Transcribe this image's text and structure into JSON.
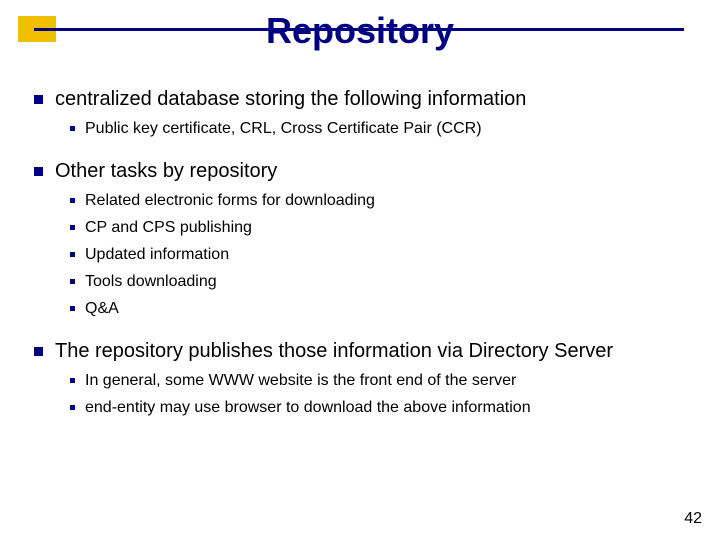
{
  "title": "Repository",
  "bullets": {
    "b1": "centralized database storing the following information",
    "b1_1": "Public key certificate, CRL, Cross Certificate Pair (CCR)",
    "b2": "Other tasks by repository",
    "b2_1": "Related electronic forms for downloading",
    "b2_2": "CP and CPS publishing",
    "b2_3": "Updated information",
    "b2_4": "Tools downloading",
    "b2_5": "Q&A",
    "b3": "The repository publishes those information via Directory Server",
    "b3_1": "In general, some WWW website is the front end of the server",
    "b3_2": "end-entity may use browser to download the above information"
  },
  "page_number": "42",
  "colors": {
    "accent_navy": "#000080",
    "accent_yellow": "#f0c000"
  }
}
